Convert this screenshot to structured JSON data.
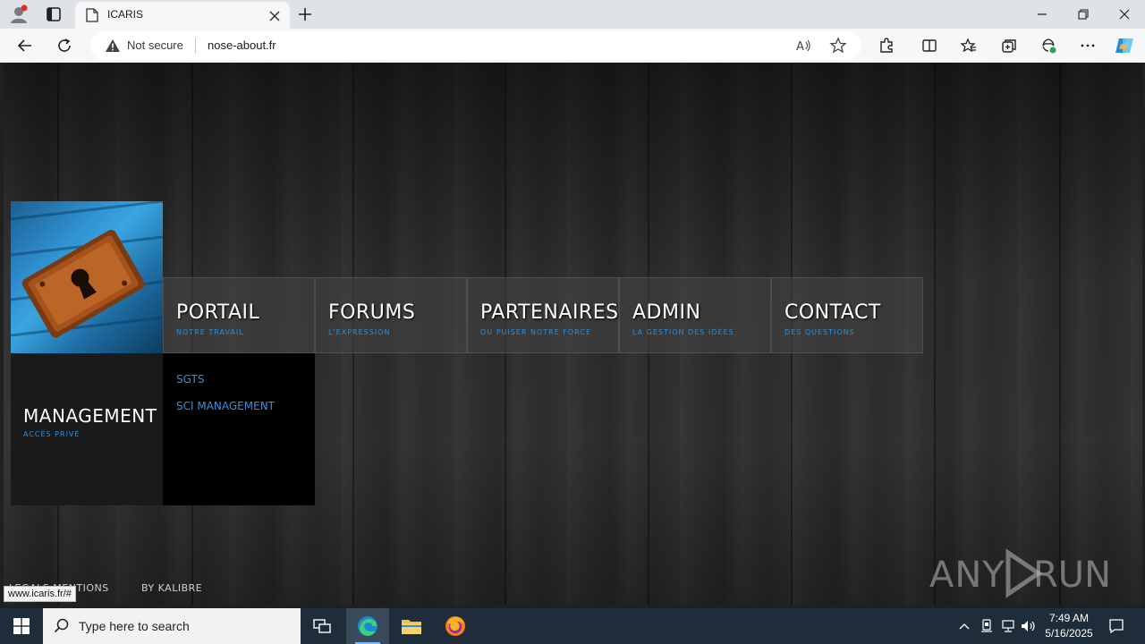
{
  "browser": {
    "tab_title": "ICARIS",
    "security_label": "Not secure",
    "url": "nose-about.fr",
    "status_url": "www.icaris.fr/#"
  },
  "site": {
    "menu": [
      {
        "title": "PORTAIL",
        "subtitle": "NOTRE TRAVAIL"
      },
      {
        "title": "FORUMS",
        "subtitle": "L'EXPRESSION"
      },
      {
        "title": "PARTENAIRES",
        "subtitle": "OU PUISER NOTRE FORCE"
      },
      {
        "title": "ADMIN",
        "subtitle": "LA GESTION DES IDÉES"
      },
      {
        "title": "CONTACT",
        "subtitle": "DES QUESTIONS"
      }
    ],
    "management": {
      "title": "MANAGEMENT",
      "subtitle": "ACCÈS PRIVÉ"
    },
    "submenu": [
      "SGTS",
      "SCI MANAGEMENT"
    ],
    "footer": {
      "legal": "LEGALS MENTIONS",
      "by": "BY KALIBRE"
    },
    "watermark": "ANY RUN"
  },
  "taskbar": {
    "search_placeholder": "Type here to search",
    "time": "7:49 AM",
    "date": "5/16/2025"
  },
  "colors": {
    "accent_blue": "#2e8fd8",
    "taskbar": "#1f2c3a",
    "chrome": "#dfe3e8"
  }
}
